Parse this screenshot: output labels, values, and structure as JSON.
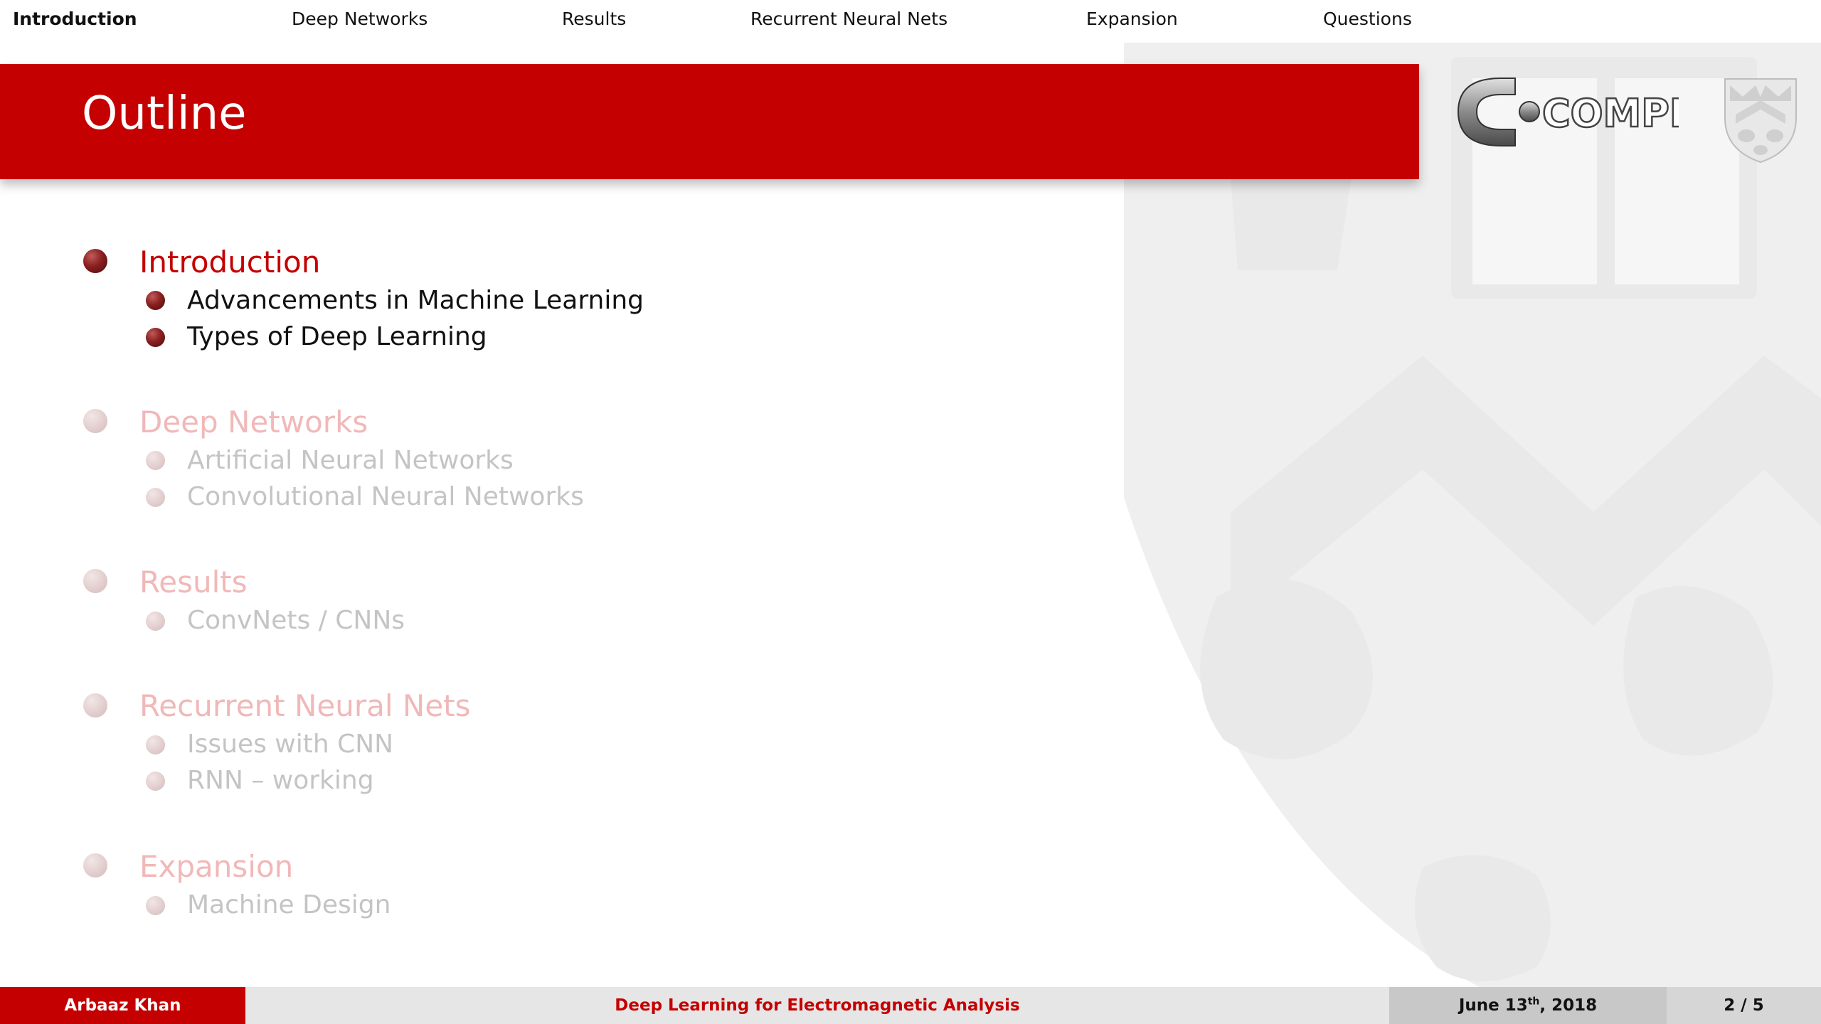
{
  "nav": {
    "items": [
      "Introduction",
      "Deep Networks",
      "Results",
      "Recurrent Neural Nets",
      "Expansion",
      "Questions"
    ],
    "active": "Introduction"
  },
  "slide": {
    "title": "Outline"
  },
  "logo": {
    "text": "COMPEM"
  },
  "outline": {
    "sections": [
      {
        "title": "Introduction",
        "active": true,
        "subs": [
          "Advancements in Machine Learning",
          "Types of Deep Learning"
        ]
      },
      {
        "title": "Deep Networks",
        "active": false,
        "subs": [
          "Artificial Neural Networks",
          "Convolutional Neural Networks"
        ]
      },
      {
        "title": "Results",
        "active": false,
        "subs": [
          "ConvNets / CNNs"
        ]
      },
      {
        "title": "Recurrent Neural Nets",
        "active": false,
        "subs": [
          "Issues with CNN",
          "RNN – working"
        ]
      },
      {
        "title": "Expansion",
        "active": false,
        "subs": [
          "Machine Design"
        ]
      }
    ]
  },
  "footer": {
    "author": "Arbaaz Khan",
    "talk_title": "Deep Learning for Electromagnetic Analysis",
    "date_main": "June 13",
    "date_sup": "th",
    "date_year": ", 2018",
    "page": "2 / 5"
  },
  "colors": {
    "accent": "#c40000",
    "footer_gray": "#e6e6e6"
  }
}
